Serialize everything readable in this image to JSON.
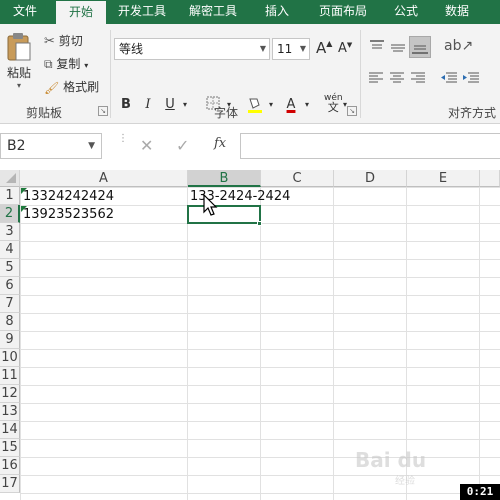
{
  "tabs": [
    "文件",
    "开始",
    "开发工具",
    "解密工具",
    "插入",
    "页面布局",
    "公式",
    "数据"
  ],
  "clipboard": {
    "paste": "粘贴",
    "cut": "剪切",
    "copy": "复制",
    "format_painter": "格式刷",
    "group_label": "剪贴板"
  },
  "font": {
    "name": "等线",
    "size": "11",
    "bold": "B",
    "italic": "I",
    "underline": "U",
    "grow": "A",
    "shrink": "A",
    "color_letter": "A",
    "phonetic": "wén",
    "group_label": "字体"
  },
  "alignment": {
    "group_label": "对齐方式"
  },
  "formula_bar": {
    "name_box": "B2",
    "fx": "fx"
  },
  "columns": [
    "A",
    "B",
    "C",
    "D",
    "E"
  ],
  "rows": [
    "1",
    "2",
    "3",
    "4",
    "5",
    "6",
    "7",
    "8",
    "9",
    "10",
    "11",
    "12",
    "13",
    "14",
    "15",
    "16",
    "17"
  ],
  "cells": {
    "A1": "13324242424",
    "A2": "13923523562",
    "B1": "133-2424-2424"
  },
  "selected_cell": "B2",
  "colors": {
    "ribbon_accent": "#217346"
  },
  "overlay": {
    "timer": "0:21",
    "watermark": "Bai du",
    "watermark_sub": "经验"
  }
}
